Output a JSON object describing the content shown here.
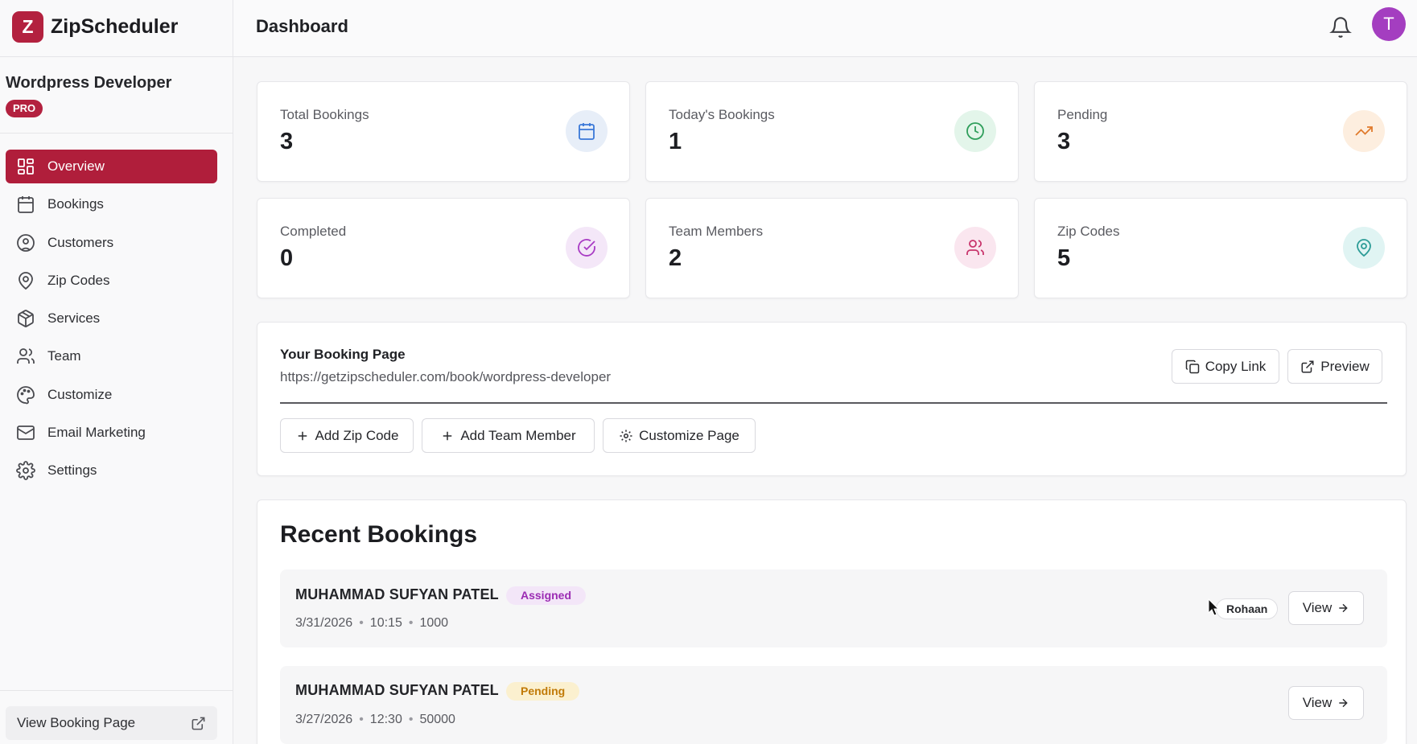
{
  "app": {
    "name": "ZipScheduler",
    "logo_letter": "Z",
    "brand_color": "#b3213f"
  },
  "workspace": {
    "name": "Wordpress Developer",
    "plan_badge": "PRO"
  },
  "sidebar": {
    "items": [
      {
        "label": "Overview",
        "icon": "grid-icon",
        "active": true
      },
      {
        "label": "Bookings",
        "icon": "calendar-icon"
      },
      {
        "label": "Customers",
        "icon": "user-circle-icon"
      },
      {
        "label": "Zip Codes",
        "icon": "map-pin-icon"
      },
      {
        "label": "Services",
        "icon": "package-icon"
      },
      {
        "label": "Team",
        "icon": "users-icon"
      },
      {
        "label": "Customize",
        "icon": "palette-icon"
      },
      {
        "label": "Email Marketing",
        "icon": "mail-icon"
      },
      {
        "label": "Settings",
        "icon": "gear-icon"
      }
    ],
    "footer_link": "View Booking Page"
  },
  "header": {
    "title": "Dashboard",
    "avatar_letter": "T",
    "avatar_color": "#a43ec0"
  },
  "stats": [
    {
      "label": "Total Bookings",
      "value": "3",
      "icon": "calendar-icon",
      "icon_bg": "#e7eef8",
      "icon_color": "#3a78d8"
    },
    {
      "label": "Today's Bookings",
      "value": "1",
      "icon": "clock-icon",
      "icon_bg": "#e3f5ea",
      "icon_color": "#2f9e5b"
    },
    {
      "label": "Pending",
      "value": "3",
      "icon": "trending-up-icon",
      "icon_bg": "#fdeedf",
      "icon_color": "#e07a2c"
    },
    {
      "label": "Completed",
      "value": "0",
      "icon": "check-circle-icon",
      "icon_bg": "#f4e7f8",
      "icon_color": "#a83bc4"
    },
    {
      "label": "Team Members",
      "value": "2",
      "icon": "users-icon",
      "icon_bg": "#fae6ef",
      "icon_color": "#c8336b"
    },
    {
      "label": "Zip Codes",
      "value": "5",
      "icon": "map-pin-icon",
      "icon_bg": "#e0f4f3",
      "icon_color": "#2d9c97"
    }
  ],
  "booking_page": {
    "title": "Your Booking Page",
    "url": "https://getzipscheduler.com/book/wordpress-developer",
    "copy_label": "Copy Link",
    "preview_label": "Preview",
    "actions": [
      "Add Zip Code",
      "Add Team Member",
      "Customize Page"
    ]
  },
  "recent": {
    "title": "Recent Bookings",
    "rows": [
      {
        "name": "MUHAMMAD SUFYAN PATEL",
        "status": "Assigned",
        "date": "3/31/2026",
        "time": "10:15",
        "zip": "1000",
        "assignee": "Rohaan",
        "view_label": "View"
      },
      {
        "name": "MUHAMMAD SUFYAN PATEL",
        "status": "Pending",
        "date": "3/27/2026",
        "time": "12:30",
        "zip": "50000",
        "view_label": "View"
      }
    ]
  }
}
